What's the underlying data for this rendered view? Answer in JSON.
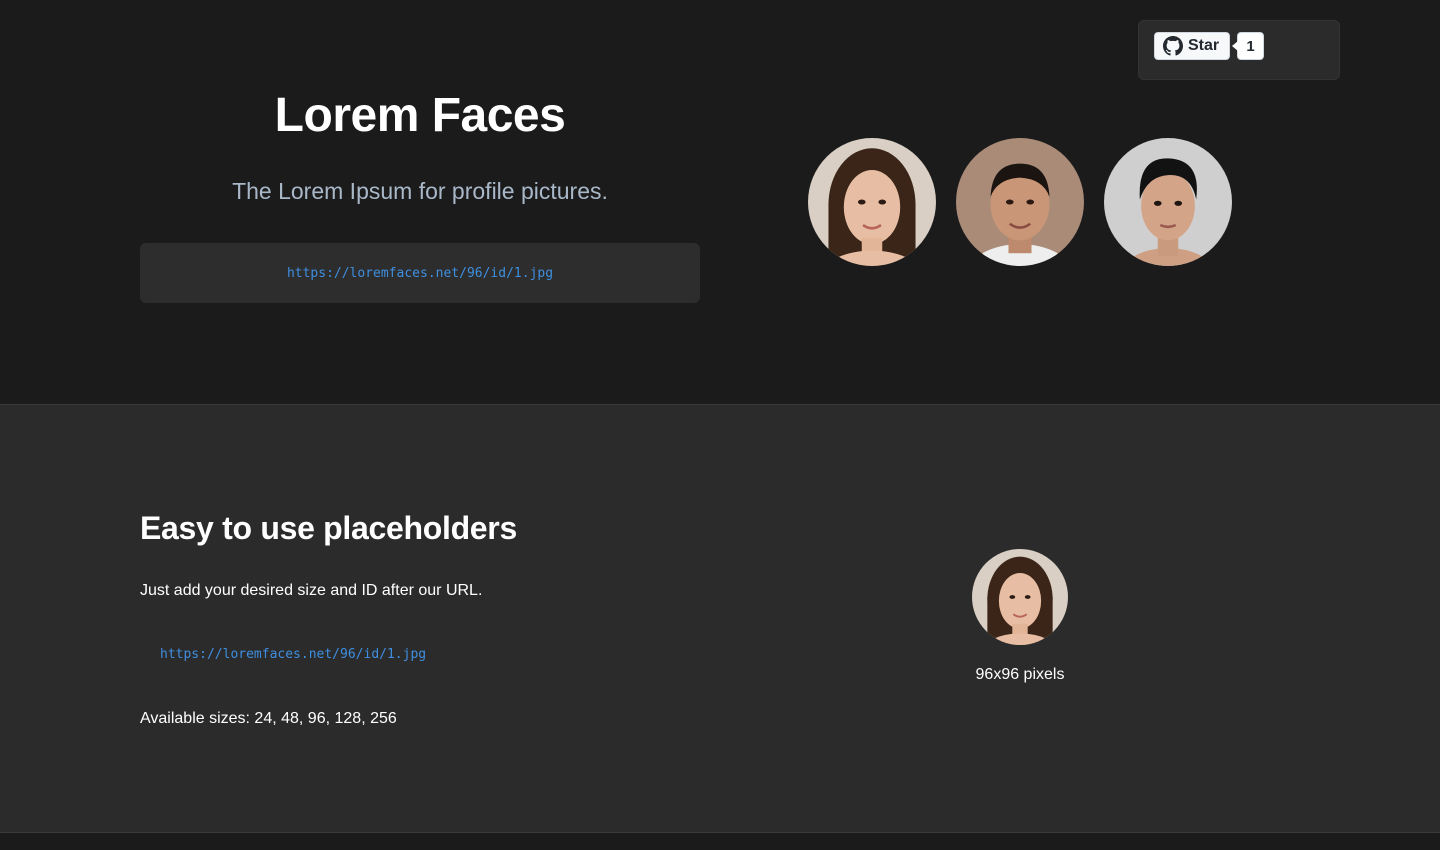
{
  "hero": {
    "title": "Lorem Faces",
    "subtitle": "The Lorem Ipsum for profile pictures.",
    "url": "https://loremfaces.net/96/id/1.jpg"
  },
  "github": {
    "star_label": "Star",
    "star_count": "1"
  },
  "faces": [
    {
      "icon": "woman-portrait",
      "bg": "#d9cfc4",
      "hair": "#3b2518",
      "skin": "#e7bea3"
    },
    {
      "icon": "man-portrait",
      "bg": "#a98b78",
      "hair": "#1c1410",
      "skin": "#c99678"
    },
    {
      "icon": "man-portrait",
      "bg": "#cfcfcf",
      "hair": "#121212",
      "skin": "#d4a488"
    }
  ],
  "section": {
    "title": "Easy to use placeholders",
    "text": "Just add your desired size and ID after our URL.",
    "url": "https://loremfaces.net/96/id/1.jpg",
    "sizes": "Available sizes: 24, 48, 96, 128, 256",
    "caption": "96x96 pixels"
  },
  "colors": {
    "background": "#1b1b1b",
    "section_background": "#2b2b2b",
    "code_link": "#3f8fe0",
    "subtitle": "#a9b8c9"
  }
}
